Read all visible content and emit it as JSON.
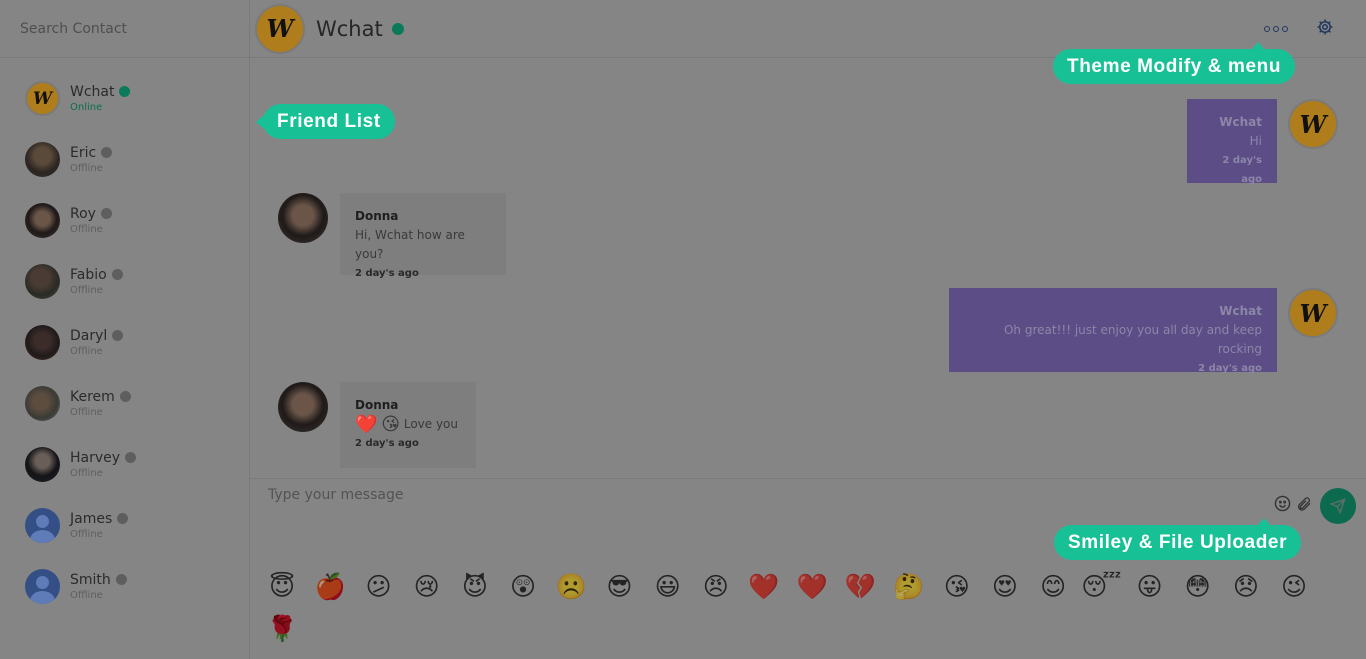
{
  "sidebar": {
    "search_placeholder": "Search Contact",
    "contacts": [
      {
        "name": "Wchat",
        "status": "Online",
        "avatar": "wchat-logo"
      },
      {
        "name": "Eric",
        "status": "Offline",
        "avatar": "photo"
      },
      {
        "name": "Roy",
        "status": "Offline",
        "avatar": "photo"
      },
      {
        "name": "Fabio",
        "status": "Offline",
        "avatar": "photo"
      },
      {
        "name": "Daryl",
        "status": "Offline",
        "avatar": "photo"
      },
      {
        "name": "Kerem",
        "status": "Offline",
        "avatar": "photo"
      },
      {
        "name": "Harvey",
        "status": "Offline",
        "avatar": "photo"
      },
      {
        "name": "James",
        "status": "Offline",
        "avatar": "default-user"
      },
      {
        "name": "Smith",
        "status": "Offline",
        "avatar": "default-user"
      }
    ]
  },
  "header": {
    "title": "Wchat",
    "status": "online"
  },
  "messages": [
    {
      "sender": "Wchat",
      "text": "Hi",
      "time": "2 day's ago",
      "outgoing": true
    },
    {
      "sender": "Donna",
      "text": "Hi, Wchat how are you?",
      "time": "2 day's ago",
      "outgoing": false
    },
    {
      "sender": "Wchat",
      "text": "Oh great!!! just enjoy you all day and keep rocking",
      "time": "2 day's ago",
      "outgoing": true
    },
    {
      "sender": "Donna",
      "emojis": [
        "❤️",
        "😘"
      ],
      "text": "Love you",
      "time": "2 day's ago",
      "outgoing": false
    }
  ],
  "composer": {
    "placeholder": "Type your message"
  },
  "emoji_tray": [
    "😇",
    "🍎",
    "😕",
    "😢",
    "😈",
    "😲",
    "☹️",
    "😎",
    "😃",
    "😠",
    "❤️",
    "❤️",
    "💔",
    "🤔",
    "😘",
    "😍",
    "😊",
    "😴",
    "😛",
    "😳",
    "😞",
    "😉",
    "🌹"
  ],
  "callouts": {
    "friend_list": "Friend List",
    "theme_menu": "Theme Modify & menu",
    "smiley_uploader": "Smiley & File Uploader"
  },
  "colors": {
    "accent": "#17c195",
    "overlay_bg": "#858585",
    "online": "#0a7a5a",
    "outgoing_bubble": "#5c4d86"
  },
  "icons": {
    "menu": "ellipsis-icon",
    "settings": "gear-icon",
    "smiley": "smiley-icon",
    "attach": "paperclip-icon",
    "send": "paper-plane-icon"
  }
}
